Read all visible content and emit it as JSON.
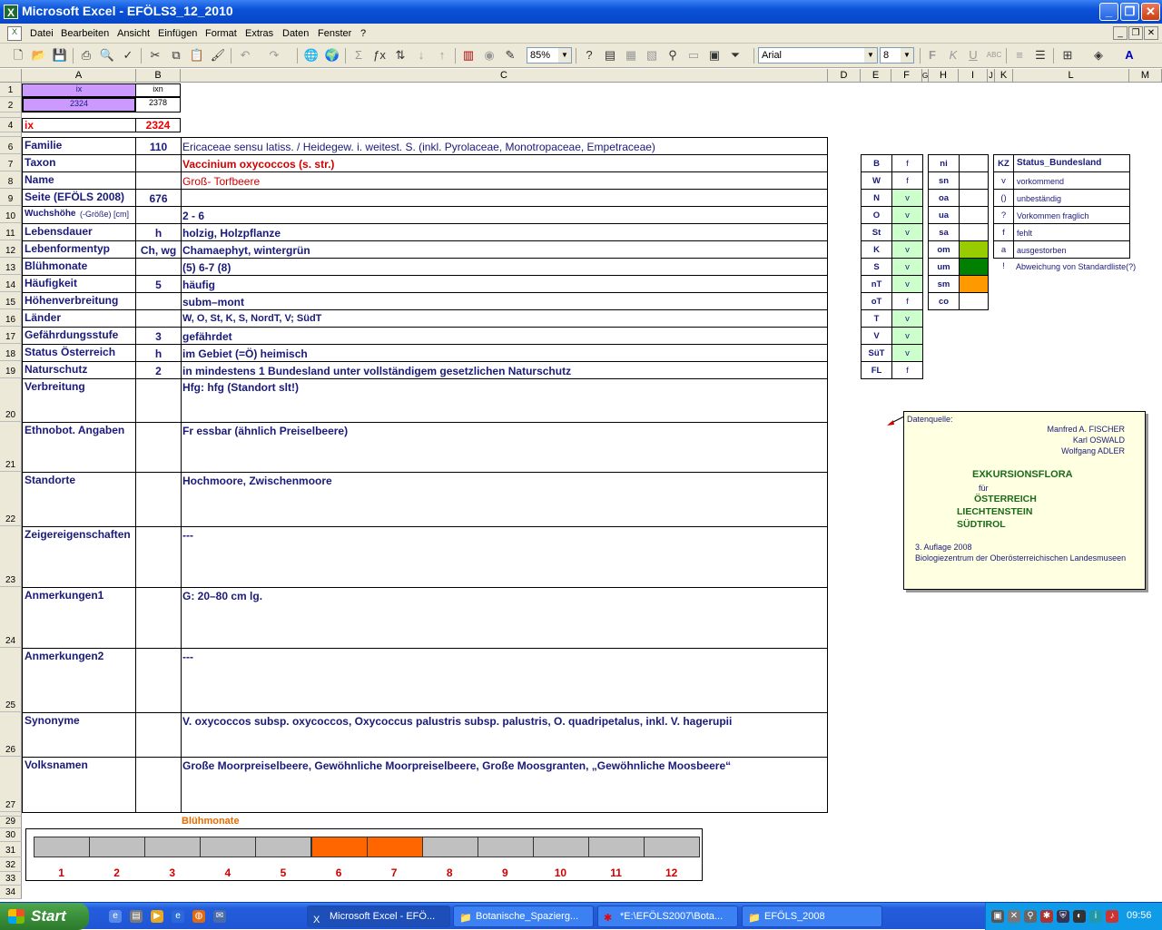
{
  "window": {
    "title": "Microsoft Excel - EFÖLS3_12_2010"
  },
  "menu": [
    "Datei",
    "Bearbeiten",
    "Ansicht",
    "Einfügen",
    "Format",
    "Extras",
    "Daten",
    "Fenster",
    "?"
  ],
  "toolbar": {
    "zoom": "85%",
    "font": "Arial",
    "size": "8"
  },
  "columns": [
    "A",
    "B",
    "C",
    "D",
    "E",
    "F",
    "G",
    "H",
    "I",
    "J",
    "K",
    "L",
    "M"
  ],
  "rows": [
    "1",
    "2",
    "3",
    "4",
    "5",
    "6",
    "7",
    "8",
    "9",
    "10",
    "11",
    "12",
    "13",
    "14",
    "15",
    "16",
    "17",
    "18",
    "19",
    "20",
    "21",
    "22",
    "23",
    "24",
    "25",
    "26",
    "27",
    "28",
    "29",
    "30",
    "31",
    "32",
    "33",
    "34"
  ],
  "top": {
    "a1": "ix",
    "b1": "ixn",
    "a2": "2324",
    "b2": "2378",
    "a4": "ix",
    "b4": "2324"
  },
  "records": [
    {
      "label": "Familie",
      "b": "110",
      "c": "Ericaceae sensu latiss.  /  Heidegew. i. weitest. S. (inkl. Pyrolaceae, Monotropaceae, Empetraceae)"
    },
    {
      "label": "Taxon",
      "b": "",
      "c": "Vaccinium oxycoccos (s. str.)"
    },
    {
      "label": "Name",
      "b": "",
      "c": "Groß- Torfbeere"
    },
    {
      "label": "Seite (EFÖLS 2008)",
      "b": "676",
      "c": ""
    },
    {
      "label": "Wuchshöhe",
      "label2": " (-Größe) [cm]",
      "b": "",
      "c": " 2 - 6"
    },
    {
      "label": "Lebensdauer",
      "b": "h",
      "c": "holzig, Holzpflanze"
    },
    {
      "label": "Lebenformentyp",
      "b": "Ch, wg",
      "c": "Chamaephyt, wintergrün"
    },
    {
      "label": "Blühmonate",
      "b": "",
      "c": "(5) 6-7 (8)"
    },
    {
      "label": "Häufigkeit",
      "b": "5",
      "c": "häufig"
    },
    {
      "label": "Höhenverbreitung",
      "b": "",
      "c": "subm–mont"
    },
    {
      "label": "Länder",
      "b": "",
      "c": "W, O, St, K, S, NordT, V; SüdT"
    },
    {
      "label": "Gefährdungsstufe",
      "b": "3",
      "c": "gefährdet"
    },
    {
      "label": "Status Österreich",
      "b": "h",
      "c": "im Gebiet (=Ö) heimisch"
    },
    {
      "label": "Naturschutz",
      "b": "2",
      "c": "in mindestens 1 Bundesland unter vollständigem gesetzlichen Naturschutz"
    },
    {
      "label": "Verbreitung",
      "b": "",
      "c": "Hfg: hfg (Standort slt!)"
    },
    {
      "label": "Ethnobot. Angaben",
      "b": "",
      "c": "Fr essbar (ähnlich Preiselbeere)"
    },
    {
      "label": "Standorte",
      "b": "",
      "c": "Hochmoore, Zwischenmoore"
    },
    {
      "label": "Zeigereigenschaften",
      "b": "",
      "c": "---"
    },
    {
      "label": "Anmerkungen1",
      "b": "",
      "c": "G: 20–80 cm lg."
    },
    {
      "label": "Anmerkungen2",
      "b": "",
      "c": "---"
    },
    {
      "label": "Synonyme",
      "b": "",
      "c": "V. oxycoccos subsp. oxycoccos,  Oxycoccus palustris subsp. palustris, O. quadripetalus, inkl. V. hagerupii"
    },
    {
      "label": "Volksnamen",
      "b": "",
      "c": "Große Moorpreiselbeere, Gewöhnliche Moorpreiselbeere,   Große Moosgranten, „Gewöhnliche Moosbeere“"
    }
  ],
  "states": [
    [
      "B",
      "f"
    ],
    [
      "W",
      "f"
    ],
    [
      "N",
      "v"
    ],
    [
      "O",
      "v"
    ],
    [
      "St",
      "v"
    ],
    [
      "K",
      "v"
    ],
    [
      "S",
      "v"
    ],
    [
      "nT",
      "v"
    ],
    [
      "oT",
      "f"
    ],
    [
      "T",
      "v"
    ],
    [
      "V",
      "v"
    ],
    [
      "SüT",
      "v"
    ],
    [
      "FL",
      "f"
    ]
  ],
  "zones": [
    {
      "k": "ni",
      "color": ""
    },
    {
      "k": "sn",
      "color": ""
    },
    {
      "k": "oa",
      "color": ""
    },
    {
      "k": "ua",
      "color": ""
    },
    {
      "k": "sa",
      "color": ""
    },
    {
      "k": "om",
      "color": "#99cc00"
    },
    {
      "k": "um",
      "color": "#008000"
    },
    {
      "k": "sm",
      "color": "#ff9900"
    },
    {
      "k": "co",
      "color": ""
    }
  ],
  "legend": {
    "header_kz": "KZ",
    "header_status": "Status_Bundesland",
    "items": [
      [
        "v",
        "vorkommend"
      ],
      [
        "()",
        "unbeständig"
      ],
      [
        "?",
        "Vorkommen fraglich"
      ],
      [
        "f",
        "fehlt"
      ],
      [
        "a",
        "ausgestorben"
      ],
      [
        "!",
        "Abweichung von Standardliste(?)"
      ]
    ]
  },
  "note": {
    "source": "Datenquelle:",
    "a1": "Manfred A. FISCHER",
    "a2": "Karl OSWALD",
    "a3": "Wolfgang ADLER",
    "t1": "EXKURSIONSFLORA",
    "t2": "für",
    "t3": "ÖSTERREICH",
    "t4": "LIECHTENSTEIN",
    "t5": "SÜDTIROL",
    "e1": "3. Auflage 2008",
    "e2": "Biologiezentrum der Oberösterreichischen Landesmuseen"
  },
  "chart_data": {
    "type": "bar",
    "title": "Blühmonate",
    "categories": [
      "1",
      "2",
      "3",
      "4",
      "5",
      "6",
      "7",
      "8",
      "9",
      "10",
      "11",
      "12"
    ],
    "flowering": [
      0,
      0,
      0,
      0,
      0,
      1,
      1,
      0,
      0,
      0,
      0,
      0
    ],
    "colors": {
      "on": "#ff6600",
      "off": "#c0c0c0"
    }
  },
  "taskbar": {
    "start": "Start",
    "tasks": [
      "Microsoft Excel - EFÖ...",
      "Botanische_Spazierg...",
      "*E:\\EFÖLS2007\\Bota...",
      "EFÖLS_2008"
    ],
    "clock": "09:56"
  }
}
